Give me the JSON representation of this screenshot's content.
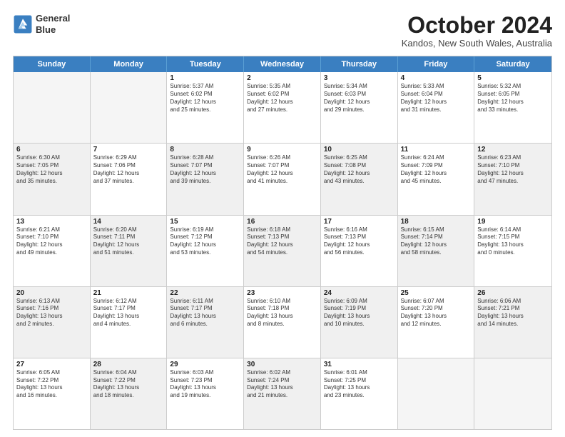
{
  "header": {
    "logo_line1": "General",
    "logo_line2": "Blue",
    "month": "October 2024",
    "location": "Kandos, New South Wales, Australia"
  },
  "weekdays": [
    "Sunday",
    "Monday",
    "Tuesday",
    "Wednesday",
    "Thursday",
    "Friday",
    "Saturday"
  ],
  "weeks": [
    [
      {
        "day": "",
        "sunrise": "",
        "sunset": "",
        "daylight": "",
        "shaded": true
      },
      {
        "day": "",
        "sunrise": "",
        "sunset": "",
        "daylight": "",
        "shaded": true
      },
      {
        "day": "1",
        "sunrise": "Sunrise: 5:37 AM",
        "sunset": "Sunset: 6:02 PM",
        "daylight": "Daylight: 12 hours",
        "daylight2": "and 25 minutes.",
        "shaded": false
      },
      {
        "day": "2",
        "sunrise": "Sunrise: 5:35 AM",
        "sunset": "Sunset: 6:02 PM",
        "daylight": "Daylight: 12 hours",
        "daylight2": "and 27 minutes.",
        "shaded": false
      },
      {
        "day": "3",
        "sunrise": "Sunrise: 5:34 AM",
        "sunset": "Sunset: 6:03 PM",
        "daylight": "Daylight: 12 hours",
        "daylight2": "and 29 minutes.",
        "shaded": false
      },
      {
        "day": "4",
        "sunrise": "Sunrise: 5:33 AM",
        "sunset": "Sunset: 6:04 PM",
        "daylight": "Daylight: 12 hours",
        "daylight2": "and 31 minutes.",
        "shaded": false
      },
      {
        "day": "5",
        "sunrise": "Sunrise: 5:32 AM",
        "sunset": "Sunset: 6:05 PM",
        "daylight": "Daylight: 12 hours",
        "daylight2": "and 33 minutes.",
        "shaded": false
      }
    ],
    [
      {
        "day": "6",
        "sunrise": "Sunrise: 6:30 AM",
        "sunset": "Sunset: 7:05 PM",
        "daylight": "Daylight: 12 hours",
        "daylight2": "and 35 minutes.",
        "shaded": true
      },
      {
        "day": "7",
        "sunrise": "Sunrise: 6:29 AM",
        "sunset": "Sunset: 7:06 PM",
        "daylight": "Daylight: 12 hours",
        "daylight2": "and 37 minutes.",
        "shaded": false
      },
      {
        "day": "8",
        "sunrise": "Sunrise: 6:28 AM",
        "sunset": "Sunset: 7:07 PM",
        "daylight": "Daylight: 12 hours",
        "daylight2": "and 39 minutes.",
        "shaded": true
      },
      {
        "day": "9",
        "sunrise": "Sunrise: 6:26 AM",
        "sunset": "Sunset: 7:07 PM",
        "daylight": "Daylight: 12 hours",
        "daylight2": "and 41 minutes.",
        "shaded": false
      },
      {
        "day": "10",
        "sunrise": "Sunrise: 6:25 AM",
        "sunset": "Sunset: 7:08 PM",
        "daylight": "Daylight: 12 hours",
        "daylight2": "and 43 minutes.",
        "shaded": true
      },
      {
        "day": "11",
        "sunrise": "Sunrise: 6:24 AM",
        "sunset": "Sunset: 7:09 PM",
        "daylight": "Daylight: 12 hours",
        "daylight2": "and 45 minutes.",
        "shaded": false
      },
      {
        "day": "12",
        "sunrise": "Sunrise: 6:23 AM",
        "sunset": "Sunset: 7:10 PM",
        "daylight": "Daylight: 12 hours",
        "daylight2": "and 47 minutes.",
        "shaded": true
      }
    ],
    [
      {
        "day": "13",
        "sunrise": "Sunrise: 6:21 AM",
        "sunset": "Sunset: 7:10 PM",
        "daylight": "Daylight: 12 hours",
        "daylight2": "and 49 minutes.",
        "shaded": false
      },
      {
        "day": "14",
        "sunrise": "Sunrise: 6:20 AM",
        "sunset": "Sunset: 7:11 PM",
        "daylight": "Daylight: 12 hours",
        "daylight2": "and 51 minutes.",
        "shaded": true
      },
      {
        "day": "15",
        "sunrise": "Sunrise: 6:19 AM",
        "sunset": "Sunset: 7:12 PM",
        "daylight": "Daylight: 12 hours",
        "daylight2": "and 53 minutes.",
        "shaded": false
      },
      {
        "day": "16",
        "sunrise": "Sunrise: 6:18 AM",
        "sunset": "Sunset: 7:13 PM",
        "daylight": "Daylight: 12 hours",
        "daylight2": "and 54 minutes.",
        "shaded": true
      },
      {
        "day": "17",
        "sunrise": "Sunrise: 6:16 AM",
        "sunset": "Sunset: 7:13 PM",
        "daylight": "Daylight: 12 hours",
        "daylight2": "and 56 minutes.",
        "shaded": false
      },
      {
        "day": "18",
        "sunrise": "Sunrise: 6:15 AM",
        "sunset": "Sunset: 7:14 PM",
        "daylight": "Daylight: 12 hours",
        "daylight2": "and 58 minutes.",
        "shaded": true
      },
      {
        "day": "19",
        "sunrise": "Sunrise: 6:14 AM",
        "sunset": "Sunset: 7:15 PM",
        "daylight": "Daylight: 13 hours",
        "daylight2": "and 0 minutes.",
        "shaded": false
      }
    ],
    [
      {
        "day": "20",
        "sunrise": "Sunrise: 6:13 AM",
        "sunset": "Sunset: 7:16 PM",
        "daylight": "Daylight: 13 hours",
        "daylight2": "and 2 minutes.",
        "shaded": true
      },
      {
        "day": "21",
        "sunrise": "Sunrise: 6:12 AM",
        "sunset": "Sunset: 7:17 PM",
        "daylight": "Daylight: 13 hours",
        "daylight2": "and 4 minutes.",
        "shaded": false
      },
      {
        "day": "22",
        "sunrise": "Sunrise: 6:11 AM",
        "sunset": "Sunset: 7:17 PM",
        "daylight": "Daylight: 13 hours",
        "daylight2": "and 6 minutes.",
        "shaded": true
      },
      {
        "day": "23",
        "sunrise": "Sunrise: 6:10 AM",
        "sunset": "Sunset: 7:18 PM",
        "daylight": "Daylight: 13 hours",
        "daylight2": "and 8 minutes.",
        "shaded": false
      },
      {
        "day": "24",
        "sunrise": "Sunrise: 6:09 AM",
        "sunset": "Sunset: 7:19 PM",
        "daylight": "Daylight: 13 hours",
        "daylight2": "and 10 minutes.",
        "shaded": true
      },
      {
        "day": "25",
        "sunrise": "Sunrise: 6:07 AM",
        "sunset": "Sunset: 7:20 PM",
        "daylight": "Daylight: 13 hours",
        "daylight2": "and 12 minutes.",
        "shaded": false
      },
      {
        "day": "26",
        "sunrise": "Sunrise: 6:06 AM",
        "sunset": "Sunset: 7:21 PM",
        "daylight": "Daylight: 13 hours",
        "daylight2": "and 14 minutes.",
        "shaded": true
      }
    ],
    [
      {
        "day": "27",
        "sunrise": "Sunrise: 6:05 AM",
        "sunset": "Sunset: 7:22 PM",
        "daylight": "Daylight: 13 hours",
        "daylight2": "and 16 minutes.",
        "shaded": false
      },
      {
        "day": "28",
        "sunrise": "Sunrise: 6:04 AM",
        "sunset": "Sunset: 7:22 PM",
        "daylight": "Daylight: 13 hours",
        "daylight2": "and 18 minutes.",
        "shaded": true
      },
      {
        "day": "29",
        "sunrise": "Sunrise: 6:03 AM",
        "sunset": "Sunset: 7:23 PM",
        "daylight": "Daylight: 13 hours",
        "daylight2": "and 19 minutes.",
        "shaded": false
      },
      {
        "day": "30",
        "sunrise": "Sunrise: 6:02 AM",
        "sunset": "Sunset: 7:24 PM",
        "daylight": "Daylight: 13 hours",
        "daylight2": "and 21 minutes.",
        "shaded": true
      },
      {
        "day": "31",
        "sunrise": "Sunrise: 6:01 AM",
        "sunset": "Sunset: 7:25 PM",
        "daylight": "Daylight: 13 hours",
        "daylight2": "and 23 minutes.",
        "shaded": false
      },
      {
        "day": "",
        "sunrise": "",
        "sunset": "",
        "daylight": "",
        "daylight2": "",
        "shaded": true
      },
      {
        "day": "",
        "sunrise": "",
        "sunset": "",
        "daylight": "",
        "daylight2": "",
        "shaded": true
      }
    ]
  ]
}
